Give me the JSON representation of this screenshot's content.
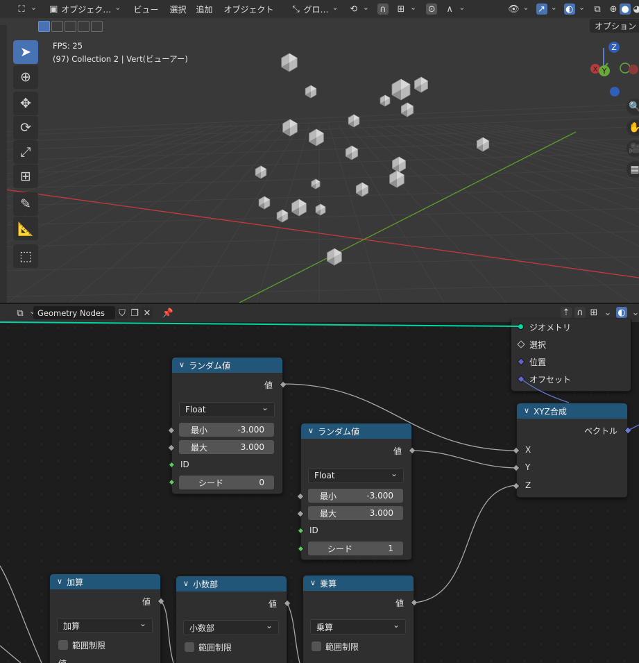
{
  "viewport": {
    "header": {
      "mode_label": "オブジェク…",
      "menus": [
        "ビュー",
        "選択",
        "追加",
        "オブジェクト"
      ],
      "orientation_label": "グロ…",
      "options_label": "オプション"
    },
    "overlay": {
      "fps": "FPS: 25",
      "collection_info": "(97) Collection 2 | Vert(ビューアー)"
    },
    "gizmo": {
      "z": "Z",
      "x": "X",
      "y": "Y"
    }
  },
  "node_editor": {
    "tree_name": "Geometry Nodes",
    "set_position_partial": {
      "inputs": [
        "ジオメトリ",
        "選択",
        "位置",
        "オフセット"
      ]
    },
    "random1": {
      "title": "ランダム値",
      "output": "値",
      "type": "Float",
      "min_label": "最小",
      "min_value": "-3.000",
      "max_label": "最大",
      "max_value": "3.000",
      "id_label": "ID",
      "seed_label": "シード",
      "seed_value": "0"
    },
    "random2": {
      "title": "ランダム値",
      "output": "値",
      "type": "Float",
      "min_label": "最小",
      "min_value": "-3.000",
      "max_label": "最大",
      "max_value": "3.000",
      "id_label": "ID",
      "seed_label": "シード",
      "seed_value": "1"
    },
    "combine_xyz": {
      "title": "XYZ合成",
      "output": "ベクトル",
      "x": "X",
      "y": "Y",
      "z": "Z"
    },
    "add": {
      "title": "加算",
      "output": "値",
      "op": "加算",
      "clamp": "範囲制限",
      "next_label": "値"
    },
    "fraction": {
      "title": "小数部",
      "output": "値",
      "op": "小数部",
      "clamp": "範囲制限"
    },
    "multiply": {
      "title": "乗算",
      "output": "値",
      "op": "乗算",
      "clamp": "範囲制限"
    }
  },
  "colors": {
    "node_header": "#225678",
    "active_tool": "#4772b3",
    "geometry_socket": "#00d6a3",
    "axis_x": "#c43a3a",
    "axis_y": "#5c9e2a"
  }
}
